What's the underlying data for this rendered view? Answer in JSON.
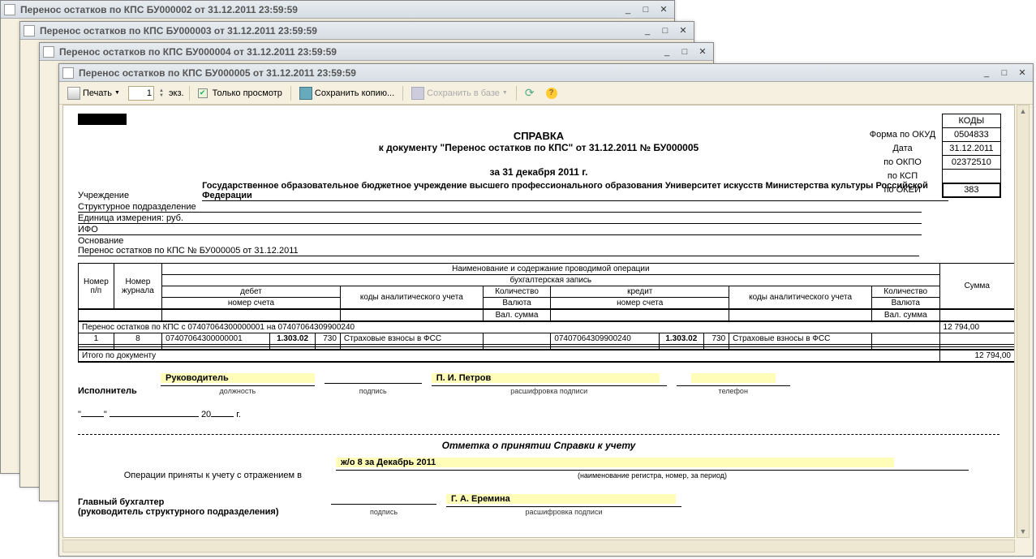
{
  "windows": [
    {
      "title": "Перенос остатков по КПС БУ000002 от 31.12.2011 23:59:59"
    },
    {
      "title": "Перенос остатков по КПС БУ000003 от 31.12.2011 23:59:59"
    },
    {
      "title": "Перенос остатков по КПС БУ000004 от 31.12.2011 23:59:59"
    },
    {
      "title": "Перенос остатков по КПС БУ000005 от 31.12.2011 23:59:59"
    }
  ],
  "toolbar": {
    "print": "Печать",
    "copies_value": "1",
    "copies_suffix": "экз.",
    "view_only": "Только просмотр",
    "save_copy": "Сохранить копию...",
    "save_db": "Сохранить в базе"
  },
  "doc": {
    "title1": "СПРАВКА",
    "title2": "к документу \"Перенос остатков по КПС\" от 31.12.2011 № БУ000005",
    "date_sub": "за 31 декабря 2011 г.",
    "org_label": "Учреждение",
    "org_value": "Государственное образовательное бюджетное учреждение высшего профессионального образования  Университет искусств Министерства культуры Российской Федерации",
    "struct_label": "Структурное подразделение",
    "ei_label": "Единица измерения: руб.",
    "ifo_label": "ИФО",
    "basis_label": "Основание",
    "basis_value": "Перенос остатков по КПС № БУ000005 от 31.12.2011"
  },
  "codes": {
    "header": "КОДЫ",
    "form_lbl": "Форма  по ОКУД",
    "form": "0504833",
    "date_lbl": "Дата",
    "date": "31.12.2011",
    "okpo_lbl": "по ОКПО",
    "okpo": "02372510",
    "ksp_lbl": "по КСП",
    "ksp": "",
    "okei_lbl": "по ОКЕИ",
    "okei": "383"
  },
  "th": {
    "np": "Номер п/п",
    "journal": "Номер журнала",
    "op_name": "Наименование и содержание проводимой операции",
    "bookrec": "бухгалтерская запись",
    "debit": "дебет",
    "credit": "кредит",
    "account": "номер счета",
    "codes_an": "коды аналитического учета",
    "qty": "Количество",
    "curr": "Валюта",
    "val_sum": "Вал. сумма",
    "sum": "Сумма"
  },
  "transfer": {
    "caption": "Перенос остатков по КПС с 07407064300000001 на 07407064309900240",
    "np": "1",
    "journal": "8",
    "d_acc": "07407064300000001",
    "d_sub": "1.303.02",
    "d_fund": "730",
    "d_desc": "Страховые взносы в ФСС",
    "c_acc": "07407064309900240",
    "c_sub": "1.303.02",
    "c_fund": "730",
    "c_desc": "Страховые взносы в ФСС",
    "sum_row": "12 794,00",
    "total_lbl": "Итого по документу",
    "sum_total": "12 794,00"
  },
  "sig": {
    "perf_lbl": "Исполнитель",
    "position_val": "Руководитель",
    "position_cap": "должность",
    "sign_cap": "подпись",
    "name_val": "П. И. Петров",
    "name_cap": "расшифровка подписи",
    "phone_cap": "телефон",
    "date_year": "20",
    "date_year_suffix": "г."
  },
  "accept": {
    "title": "Отметка о принятии Справки к учету",
    "line1": "Операции приняты к учету с отражением в",
    "reg": "ж/о 8 за Декабрь 2011",
    "reg_cap": "(наименование регистра, номер, за период)",
    "chief_lbl": "Главный бухгалтер",
    "chief_lbl2": "(руководитель структурного подразделения)",
    "chief_name": "Г. А. Еремина"
  }
}
